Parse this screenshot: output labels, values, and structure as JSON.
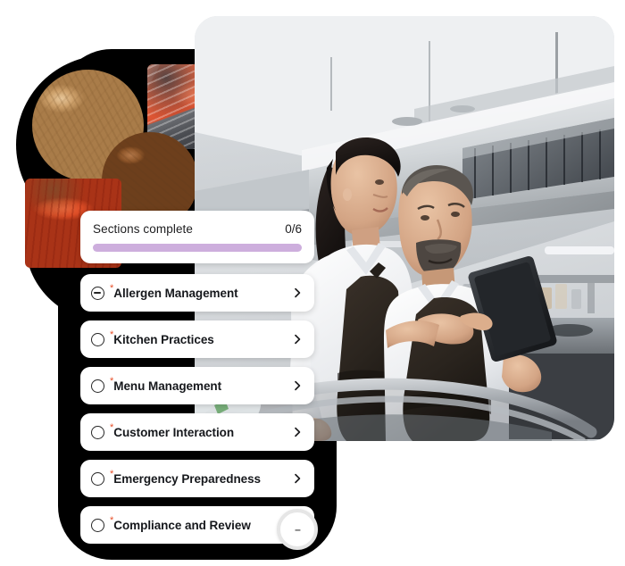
{
  "progress": {
    "label": "Sections complete",
    "count_text": "0/6",
    "completed": 0,
    "total": 6,
    "percent": 0,
    "track_color": "#cdaedd",
    "fill_color": "#7b3fa0"
  },
  "sections": [
    {
      "label": "Allergen Management",
      "state": "partial",
      "required": true,
      "required_marker": "*",
      "chevron": "chevron-right"
    },
    {
      "label": "Kitchen Practices",
      "state": "incomplete",
      "required": true,
      "required_marker": "*",
      "chevron": "chevron-right"
    },
    {
      "label": "Menu Management",
      "state": "incomplete",
      "required": true,
      "required_marker": "*",
      "chevron": "chevron-right"
    },
    {
      "label": "Customer Interaction",
      "state": "incomplete",
      "required": true,
      "required_marker": "*",
      "chevron": "chevron-right"
    },
    {
      "label": "Emergency Preparedness",
      "state": "incomplete",
      "required": true,
      "required_marker": "*",
      "chevron": "chevron-right"
    },
    {
      "label": "Compliance and Review",
      "state": "incomplete",
      "required": true,
      "required_marker": "*",
      "chevron": "chevron-right"
    }
  ],
  "fab": {
    "glyph": "–",
    "icon": "dash-icon"
  },
  "media": {
    "hero": {
      "icon": "kitchen-staff-photo",
      "description": "Two chefs in white shirts and dark aprons reviewing a tablet in a commercial kitchen"
    },
    "collage": [
      {
        "icon": "peanuts-photo",
        "shape": "circle",
        "description": "Pile of peanuts in shells"
      },
      {
        "icon": "salmon-photo",
        "shape": "square",
        "description": "Raw salmon fillets on slate"
      },
      {
        "icon": "mixed-nuts-photo",
        "shape": "circle",
        "description": "Assorted almonds, cashews and walnuts"
      },
      {
        "icon": "lobster-photo",
        "shape": "square",
        "description": "Cooked red lobsters on dark slate"
      }
    ]
  },
  "colors": {
    "panel": "#000000",
    "card": "#ffffff",
    "text": "#16181c",
    "required_star": "#e8502a",
    "progress_track": "#cdaedd",
    "progress_fill": "#7b3fa0",
    "fab_ring": "#e6e6e6"
  }
}
